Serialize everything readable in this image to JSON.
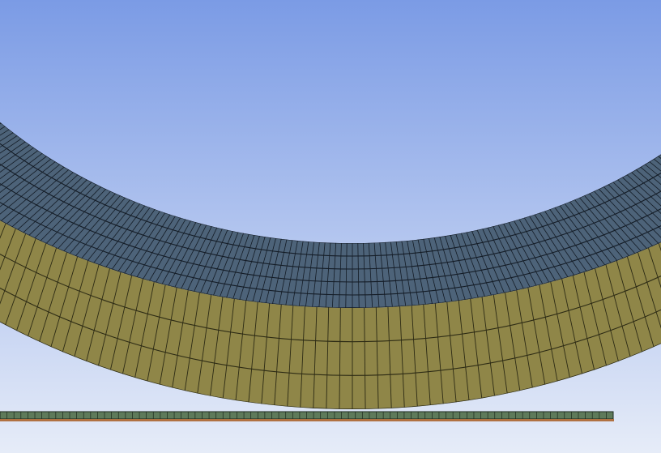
{
  "viewport": {
    "background_top": "#7b9be5",
    "background_bottom": "#e6ecf8"
  },
  "mesh": {
    "outer_ring": {
      "fill": "#4d6379",
      "line": "#141c26",
      "radial_divisions": 260,
      "circumferential_layers": 5
    },
    "inner_ring": {
      "fill": "#8f8648",
      "line": "#2c2a14",
      "radial_divisions": 130,
      "circumferential_layers": 3
    }
  },
  "ground_strip": {
    "fill": "#5e7a5a",
    "line": "#1d2a1d",
    "base_fill": "#b07142",
    "segments": 88
  }
}
